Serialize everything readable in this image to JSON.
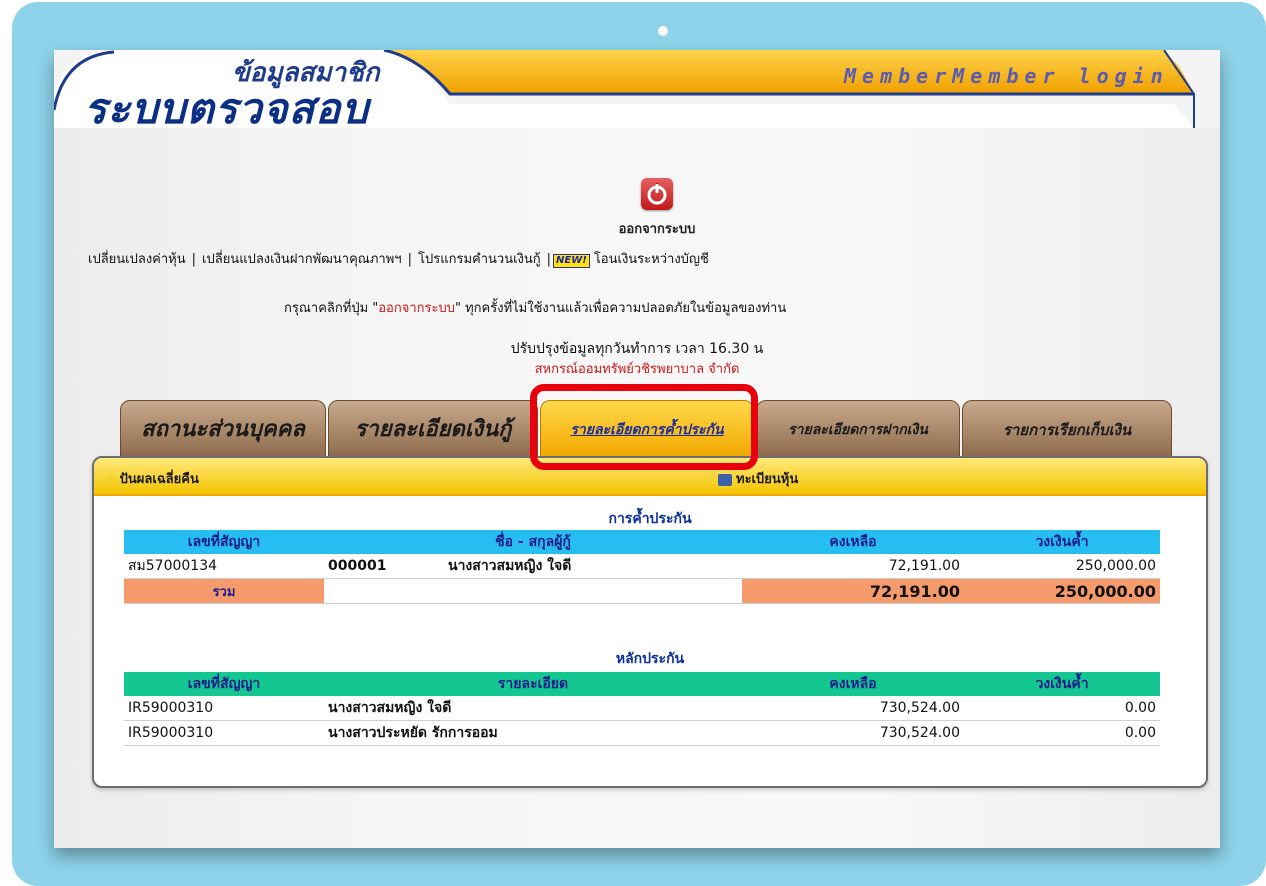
{
  "banner": {
    "logo_small": "ข้อมูลสมาชิก",
    "logo_big": "ระบบตรวจสอบ",
    "login_text": "MemberMember login"
  },
  "logout": {
    "icon": "power-icon",
    "label": "ออกจากระบบ"
  },
  "links": {
    "item1": "เปลี่ยนเปลงค่าหุ้น",
    "item2": "เปลี่ยนแปลงเงินฝากพัฒนาคุณภาพฯ",
    "item3": "โปรแกรมคำนวนเงินกู้",
    "new_badge": "NEW!",
    "item4": "โอนเงินระหว่างบัญชี",
    "separator": "|"
  },
  "notice": {
    "prefix": "กรุณาคลิกที่ปุ่ม \"",
    "highlight": "ออกจากระบบ",
    "suffix": "\" ทุกครั้งที่ไม่ใช้งานแล้วเพื่อความปลอดภัยในข้อมูลของท่าน"
  },
  "update_text": "ปรับปรุงข้อมูลทุกวันทำการ  เวลา 16.30 น",
  "coop_name": "สหกรณ์ออมทรัพย์วชิรพยาบาล จำกัด",
  "tabs": [
    "สถานะส่วนบุคคล",
    "รายละเอียดเงินกู้",
    "รายละเอียดการค้ำประกัน",
    "รายละเอียดการฝากเงิน",
    "รายการเรียกเก็บเงิน"
  ],
  "panel": {
    "left_link": "ปันผลเฉลี่ยคืน",
    "right_link": "ทะเบียนหุ้น"
  },
  "guarantee": {
    "title": "การค้ำประกัน",
    "columns": [
      "เลขที่สัญญา",
      "ชื่อ - สกุลผู้กู้",
      "คงเหลือ",
      "วงเงินค้ำ"
    ],
    "rows": [
      {
        "contract": "สม57000134",
        "member_no": "000001",
        "name": "นางสาวสมหญิง  ใจดี",
        "balance": "72,191.00",
        "limit": "250,000.00"
      }
    ],
    "total_label": "รวม",
    "total_balance": "72,191.00",
    "total_limit": "250,000.00"
  },
  "collateral": {
    "title": "หลักประกัน",
    "columns": [
      "เลขที่สัญญา",
      "รายละเอียด",
      "คงเหลือ",
      "วงเงินค้ำ"
    ],
    "rows": [
      {
        "contract": "IR59000310",
        "detail": "นางสาวสมหญิง  ใจดี",
        "balance": "730,524.00",
        "limit": "0.00"
      },
      {
        "contract": "IR59000310",
        "detail": "นางสาวประหยัด  รักการออม",
        "balance": "730,524.00",
        "limit": "0.00"
      }
    ]
  },
  "colors": {
    "frame": "#8ed3ea",
    "active_tab": "#ffd84a",
    "highlight_box": "#e8000e",
    "blue_header": "#26bdf0",
    "green_header": "#14c791",
    "total_row": "#f59a6a"
  }
}
